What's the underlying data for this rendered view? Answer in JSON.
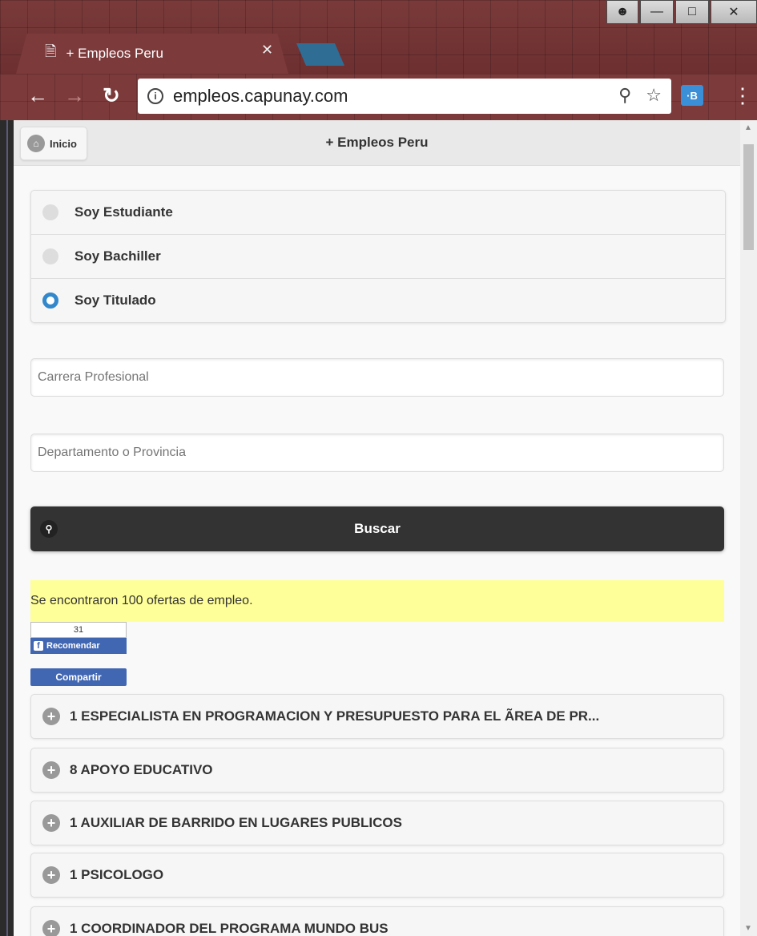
{
  "browser": {
    "tab_title": "+ Empleos Peru",
    "url": "empleos.capunay.com",
    "ext_label": "·B",
    "icons": {
      "back": "arrow-left",
      "forward": "arrow-right",
      "reload": "reload",
      "info": "info",
      "zoom": "zoom-out",
      "star": "star",
      "menu": "kebab"
    }
  },
  "header": {
    "home_label": "Inicio",
    "title": "+ Empleos Peru"
  },
  "radios": [
    {
      "label": "Soy Estudiante",
      "checked": false
    },
    {
      "label": "Soy Bachiller",
      "checked": false
    },
    {
      "label": "Soy Titulado",
      "checked": true
    }
  ],
  "inputs": {
    "career_placeholder": "Carrera Profesional",
    "location_placeholder": "Departamento o Provincia"
  },
  "search": {
    "label": "Buscar"
  },
  "notice": "Se encontraron 100 ofertas de empleo.",
  "facebook": {
    "count": "31",
    "like_label": "Recomendar",
    "share_label": "Compartir"
  },
  "jobs": [
    "1 ESPECIALISTA EN PROGRAMACION Y PRESUPUESTO PARA EL ÃREA DE PR...",
    "8 APOYO EDUCATIVO",
    "1 AUXILIAR DE BARRIDO EN LUGARES PUBLICOS",
    "1 PSICOLOGO",
    "1 COORDINADOR DEL PROGRAMA MUNDO BUS"
  ],
  "colors": {
    "accent": "#3388cc",
    "button_dark": "#333333",
    "notice_bg": "#ffff99",
    "facebook": "#4267b2"
  }
}
